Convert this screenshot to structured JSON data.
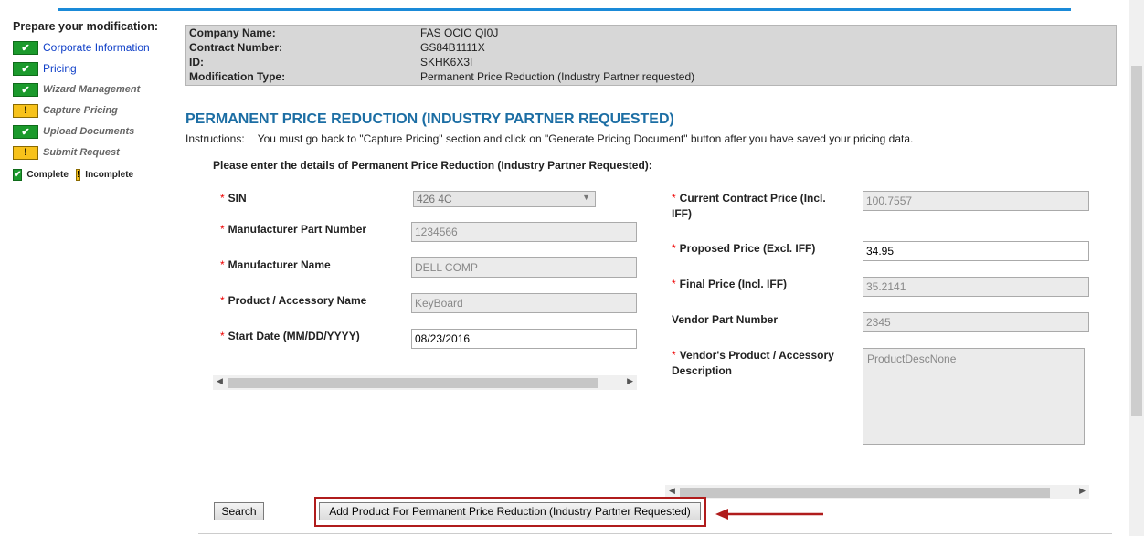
{
  "sidebar": {
    "title": "Prepare your modification:",
    "steps": [
      {
        "label": "Corporate Information",
        "status": "complete"
      },
      {
        "label": "Pricing",
        "status": "complete"
      },
      {
        "label": "Wizard Management",
        "status": "complete"
      },
      {
        "label": "Capture Pricing",
        "status": "incomplete"
      },
      {
        "label": "Upload Documents",
        "status": "complete"
      },
      {
        "label": "Submit Request",
        "status": "incomplete"
      }
    ],
    "legend": {
      "complete": "Complete",
      "incomplete": "Incomplete"
    },
    "icons": {
      "complete": "checkmark-icon",
      "incomplete": "exclamation-icon"
    },
    "colors": {
      "complete": "#1b9a2c",
      "incomplete": "#f7c21b"
    }
  },
  "info": {
    "company_label": "Company Name:",
    "company_value": "FAS OCIO QI0J",
    "contract_label": "Contract Number:",
    "contract_value": "GS84B1111X",
    "id_label": "ID:",
    "id_value": "SKHK6X3I",
    "modtype_label": "Modification Type:",
    "modtype_value": "Permanent Price Reduction (Industry Partner requested)"
  },
  "page": {
    "heading": "PERMANENT PRICE REDUCTION (INDUSTRY PARTNER REQUESTED)",
    "instructions_label": "Instructions:",
    "instructions_text": "You must go back to \"Capture Pricing\" section and click on \"Generate Pricing Document\" button after you have saved your pricing data.",
    "enter_details": "Please enter the details of Permanent Price Reduction (Industry Partner Requested):"
  },
  "form": {
    "required_mark": "*",
    "sin_label": "SIN",
    "sin_value": "426 4C",
    "mpn_label": "Manufacturer Part Number",
    "mpn_value": "1234566",
    "mname_label": "Manufacturer Name",
    "mname_value": "DELL COMP",
    "product_label": "Product / Accessory Name",
    "product_value": "KeyBoard",
    "start_label": "Start Date (MM/DD/YYYY)",
    "start_value": "08/23/2016",
    "current_label": "Current Contract Price (Incl. IFF)",
    "current_value": "100.7557",
    "proposed_label": "Proposed Price (Excl. IFF)",
    "proposed_value": "34.95",
    "final_label": "Final Price (Incl. IFF)",
    "final_value": "35.2141",
    "vpn_label": "Vendor Part Number",
    "vpn_value": "2345",
    "vdesc_label": "Vendor's Product / Accessory Description",
    "vdesc_value": "ProductDescNone"
  },
  "buttons": {
    "search": "Search",
    "add": "Add Product For Permanent Price Reduction (Industry Partner Requested)"
  },
  "glyphs": {
    "check": "✔",
    "warn": "!",
    "down": "▼",
    "left": "◀",
    "right": "▶"
  }
}
